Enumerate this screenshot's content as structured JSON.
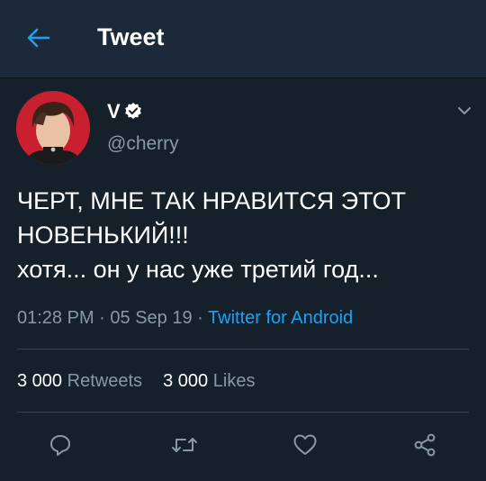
{
  "header": {
    "back_icon": "arrow-left-icon",
    "title": "Tweet"
  },
  "tweet": {
    "author": {
      "display_name": "V",
      "verified": true,
      "handle": "@cherry"
    },
    "text_lines": [
      "ЧЕРТ, МНЕ ТАК НРАВИТСЯ ЭТОТ",
      "НОВЕНЬКИЙ!!!",
      "хотя... он у нас уже третий год..."
    ],
    "time": "01:28 PM",
    "date": "05 Sep 19",
    "separator": "·",
    "source": "Twitter for Android",
    "stats": {
      "retweets_count": "3 000",
      "retweets_label": "Retweets",
      "likes_count": "3 000",
      "likes_label": "Likes"
    }
  },
  "actions": [
    "reply-icon",
    "retweet-icon",
    "like-icon",
    "share-icon"
  ],
  "colors": {
    "background": "#15202b",
    "header_bg": "#1c2938",
    "accent": "#1da1f2",
    "secondary_text": "#8899a6",
    "divider": "#38444d"
  }
}
